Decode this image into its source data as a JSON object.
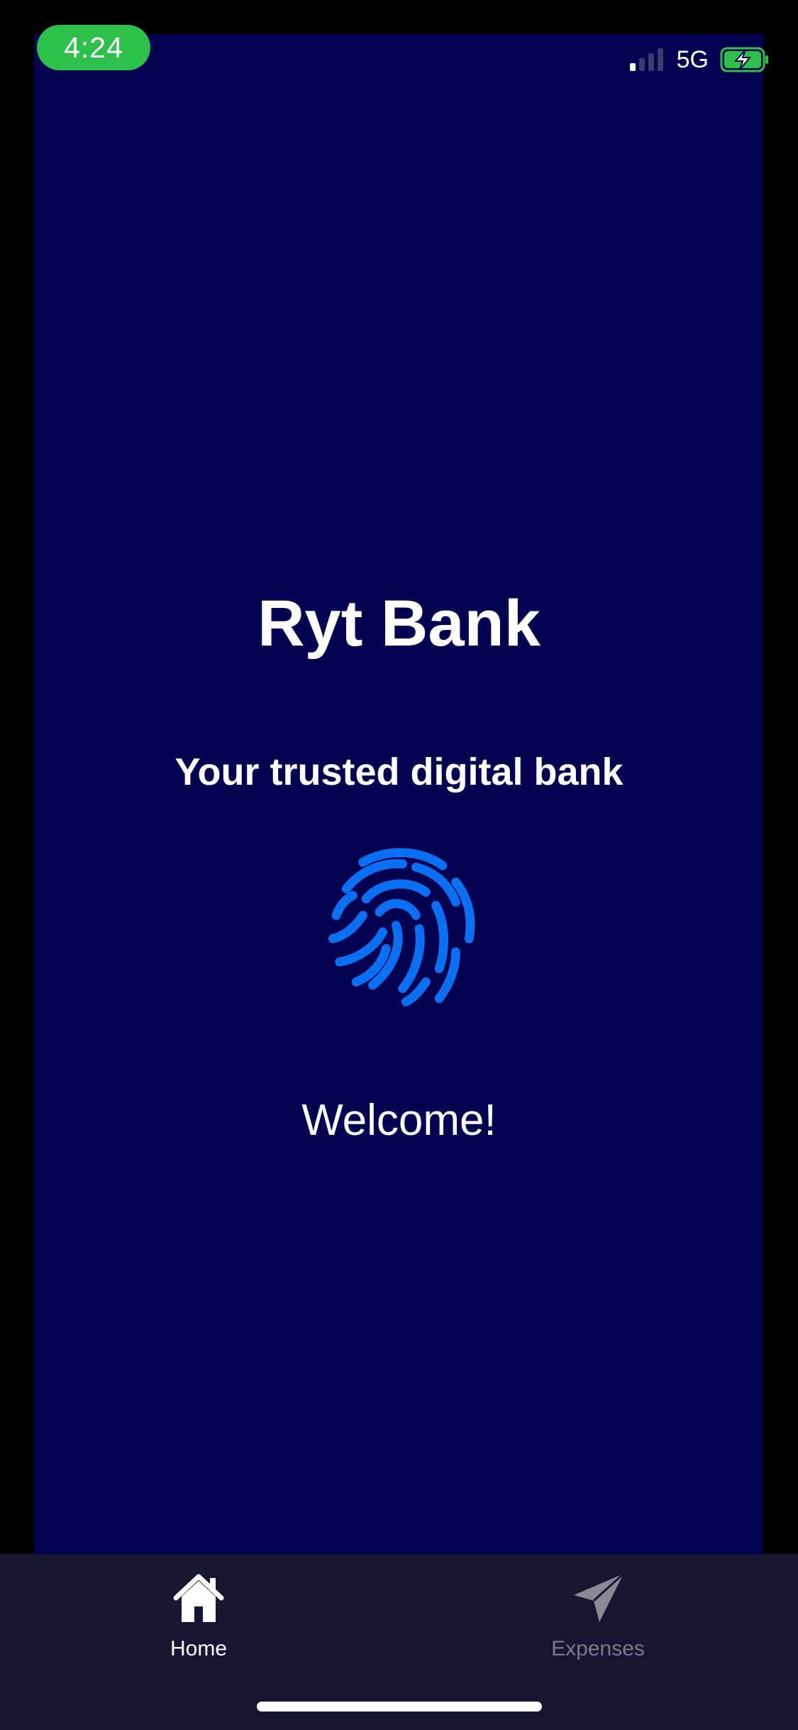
{
  "status_bar": {
    "time": "4:24",
    "network": "5G",
    "signal_icon": "cellular-signal-icon",
    "battery_icon": "battery-charging-icon",
    "time_pill_color": "#2ec04a"
  },
  "main": {
    "title": "Ryt Bank",
    "subtitle": "Your trusted digital bank",
    "fingerprint_icon": "fingerprint-icon",
    "fingerprint_color": "#0a6ff0",
    "welcome": "Welcome!",
    "background_color": "#020251"
  },
  "tab_bar": {
    "background_color": "#161632",
    "tabs": [
      {
        "label": "Home",
        "icon": "home-icon",
        "active": true
      },
      {
        "label": "Expenses",
        "icon": "paper-plane-icon",
        "active": false
      }
    ]
  }
}
